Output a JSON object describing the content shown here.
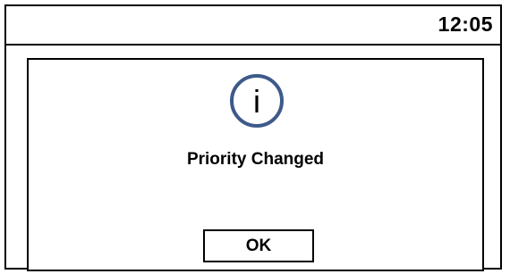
{
  "status_bar": {
    "time": "12:05"
  },
  "dialog": {
    "icon": "info-icon",
    "icon_glyph": "i",
    "icon_color": "#3d5a8a",
    "message": "Priority Changed",
    "ok_label": "OK"
  }
}
